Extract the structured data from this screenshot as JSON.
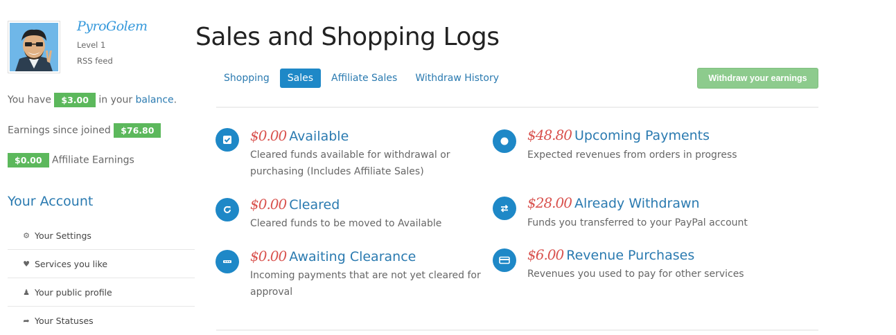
{
  "profile": {
    "username": "PyroGolem",
    "level": "Level 1",
    "rss": "RSS feed"
  },
  "balance": {
    "prefix": "You have",
    "amount": "$3.00",
    "middle": "in your",
    "link": "balance",
    "suffix": "."
  },
  "earnings": {
    "label": "Earnings since joined",
    "amount": "$76.80"
  },
  "affiliate": {
    "amount": "$0.00",
    "label": "Affiliate Earnings"
  },
  "account": {
    "title": "Your Account",
    "items": [
      {
        "label": "Your Settings",
        "icon": "gears-icon"
      },
      {
        "label": "Services you like",
        "icon": "heart-icon"
      },
      {
        "label": "Your public profile",
        "icon": "user-icon"
      },
      {
        "label": "Your Statuses",
        "icon": "share-icon"
      }
    ]
  },
  "page": {
    "title": "Sales and Shopping Logs"
  },
  "tabs": [
    {
      "label": "Shopping",
      "active": false
    },
    {
      "label": "Sales",
      "active": true
    },
    {
      "label": "Affiliate Sales",
      "active": false
    },
    {
      "label": "Withdraw History",
      "active": false
    }
  ],
  "withdraw_button": "Withdraw your earnings",
  "stats": {
    "available": {
      "amount": "$0.00",
      "label": "Available",
      "desc1": "Cleared funds available for withdrawal or",
      "desc2": "purchasing (Includes Affiliate Sales)",
      "icon": "check-square-icon"
    },
    "cleared": {
      "amount": "$0.00",
      "label": "Cleared",
      "desc1": "Cleared funds to be moved to Available",
      "icon": "refresh-icon"
    },
    "awaiting": {
      "amount": "$0.00",
      "label": "Awaiting Clearance",
      "desc1": "Incoming payments that are not yet cleared for",
      "desc2": "approval",
      "icon": "ellipsis-icon"
    },
    "upcoming": {
      "amount": "$48.80",
      "label": "Upcoming Payments",
      "desc1": "Expected revenues from orders in progress",
      "icon": "dot-circle-icon"
    },
    "withdrawn": {
      "amount": "$28.00",
      "label": "Already Withdrawn",
      "desc1": "Funds you transferred to your PayPal account",
      "icon": "exchange-icon"
    },
    "purchases": {
      "amount": "$6.00",
      "label": "Revenue Purchases",
      "desc1": "Revenues you used to pay for other services",
      "icon": "credit-card-icon"
    }
  },
  "colors": {
    "accent": "#1e88c7",
    "badge": "#5cb85c",
    "amount": "#d9534f",
    "link": "#2a7ab0"
  }
}
